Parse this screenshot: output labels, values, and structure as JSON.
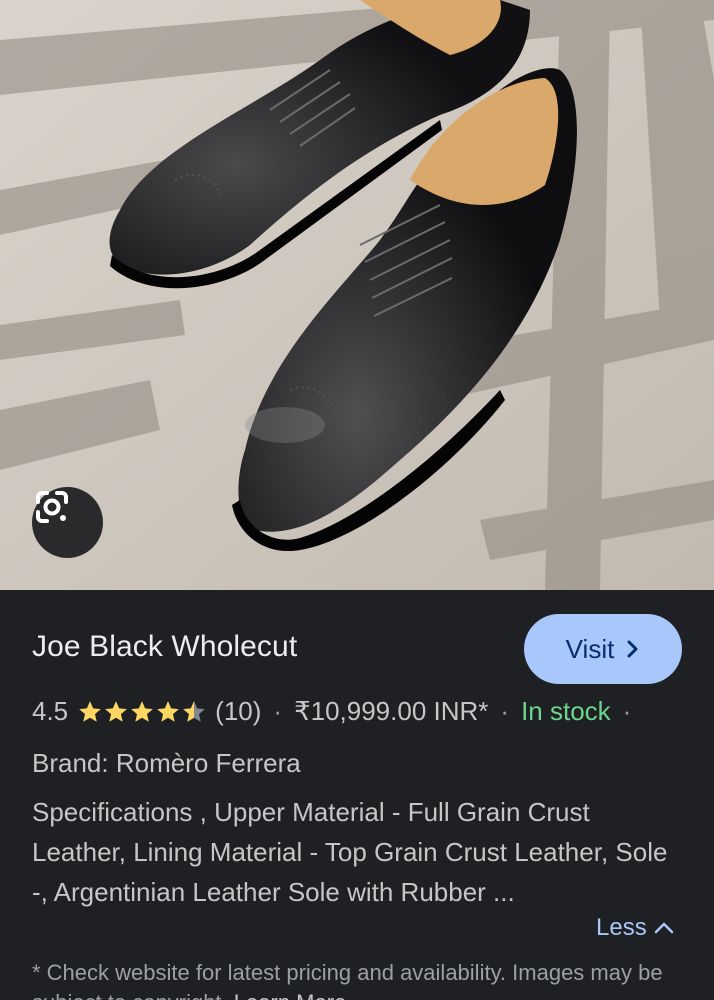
{
  "image": {
    "alt": "",
    "lens_icon": "google-lens-icon"
  },
  "product": {
    "title": "Joe Black Wholecut",
    "visit_label": "Visit",
    "rating": "4.5",
    "rating_value": 4.5,
    "review_count": "(10)",
    "price": "₹10,999.00 INR*",
    "stock": "In stock",
    "brand": "Brand: Romèro Ferrera",
    "specs": "Specifications , Upper Material - Full Grain Crust Leather, Lining Material - Top Grain Crust Leather, Sole -, Argentinian Leather Sole with Rubber ...",
    "less_label": "Less",
    "disclaimer": "* Check website for latest pricing and availability. Images may be subject to copyright.",
    "learn_more": "Learn More"
  },
  "colors": {
    "panel_bg": "#1f2023",
    "visit_bg": "#a8c7fa",
    "stock_green": "#6dd58c",
    "star_yellow": "#fdd663",
    "link_blue": "#a8c7fa"
  }
}
